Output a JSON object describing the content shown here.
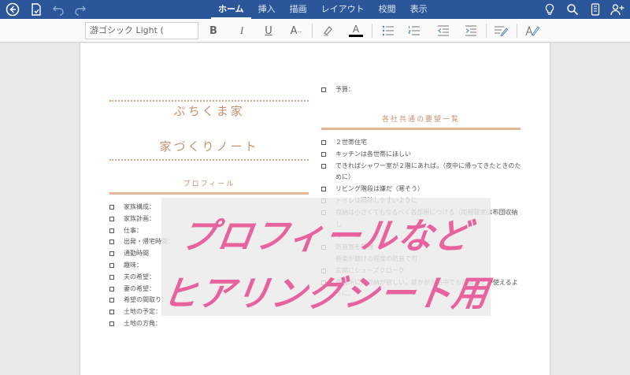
{
  "titlebar": {
    "tabs": [
      "ホーム",
      "挿入",
      "描画",
      "レイアウト",
      "校閲",
      "表示"
    ],
    "active_tab": "ホーム",
    "left_icons": [
      "back-circle-icon",
      "file-save-icon",
      "undo-icon",
      "redo-icon"
    ],
    "right_icons": [
      "lightbulb-icon",
      "search-icon",
      "phone-icon",
      "add-person-icon"
    ]
  },
  "ribbon": {
    "font_name": "游ゴシック Light (",
    "bold": "B",
    "italic": "I",
    "underline": "U",
    "font_size": "A",
    "font_color_letter": "A"
  },
  "doc": {
    "title_line1": "ぷちくま家",
    "title_line2": "家づくりノート",
    "profile_heading": "プロフィール",
    "profile_items": [
      "家族構成：",
      "家族計画：",
      "仕事：",
      "出発・帰宅時間：",
      "通勤時間",
      "趣味：",
      "夫の希望：",
      "妻の希望：",
      "希望の間取り：",
      "土地の予定：",
      "土地の方角："
    ],
    "budget_item": "予算：",
    "common_heading": "各社共通の要望一覧",
    "common_items": [
      "２世帯住宅",
      "キッチンは各世帯にほしい",
      "できればシャワー室が２階にあれば。（夜中に帰ってきたときのために）",
      "リビング階段は嫌だ（寒そう）",
      "トイレは掃除しやすいように",
      "収納は小さくてもなるべく各部屋につける（両親寝室は布団収納し",
      "て",
      "防音室を重視",
      "音楽が聴ける程度の防音で可",
      "玄関にシューズクローク",
      "",
      "洗面所には収納が欲しい。誰かが入浴中でも洗面などが使えるように。"
    ]
  },
  "overlay": {
    "line1": "プロフィールなど",
    "line2": "ヒアリングシート用"
  }
}
